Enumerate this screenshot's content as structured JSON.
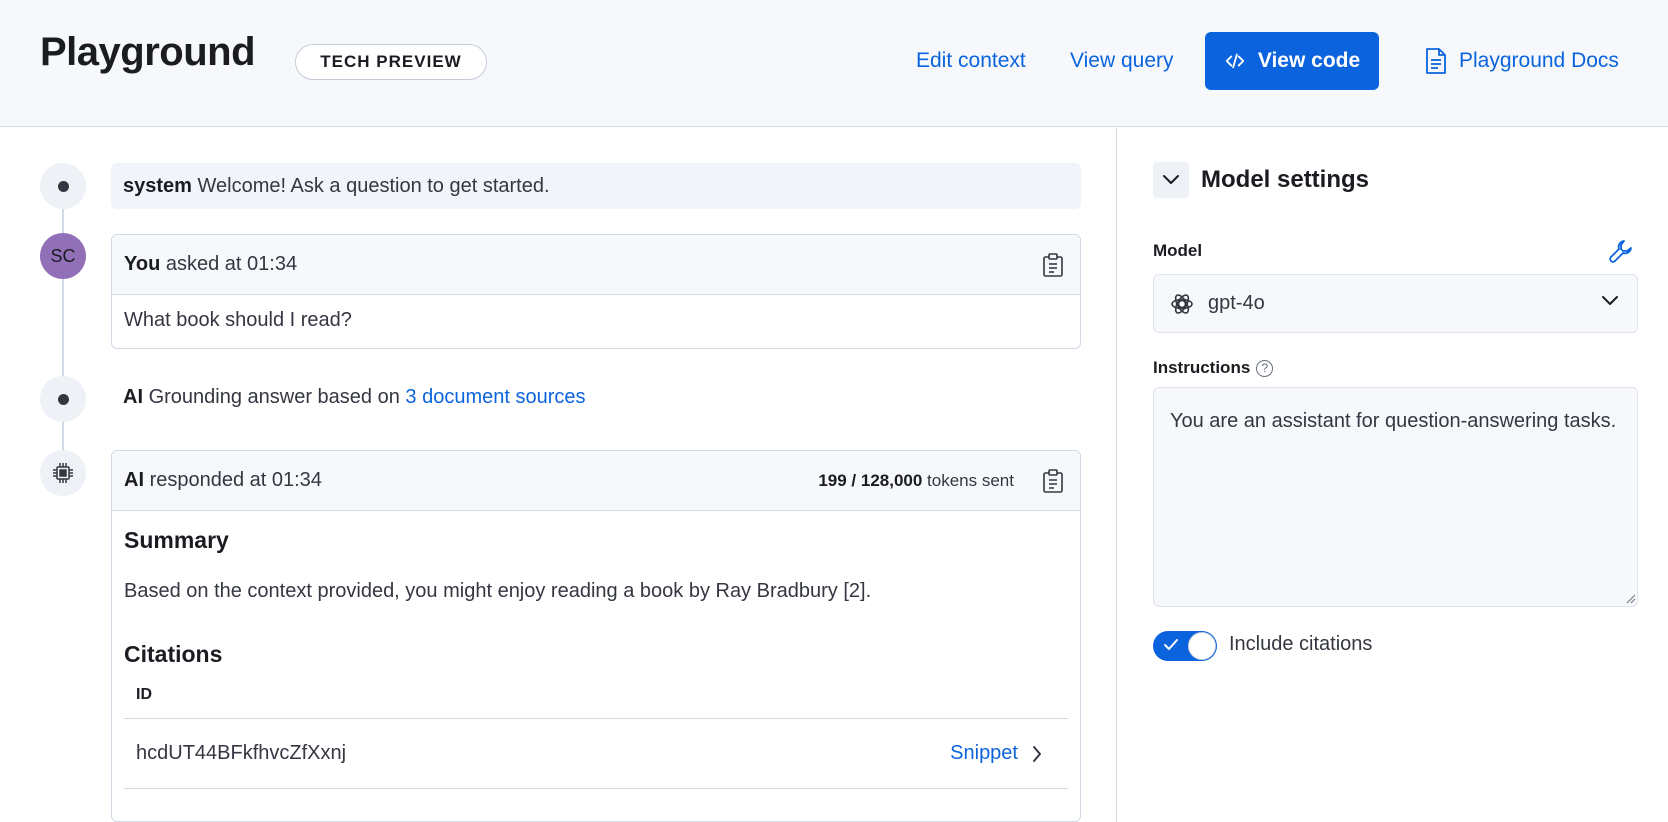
{
  "header": {
    "title": "Playground",
    "badge": "TECH PREVIEW",
    "edit_context": "Edit context",
    "view_query": "View query",
    "view_code": "View code",
    "docs": "Playground Docs"
  },
  "conversation": {
    "system": {
      "role": "system",
      "text": "Welcome! Ask a question to get started."
    },
    "user": {
      "avatar_initials": "SC",
      "role": "You",
      "meta": "asked at 01:34",
      "message": "What book should I read?"
    },
    "grounding": {
      "role": "AI",
      "text": "Grounding answer based on",
      "link": "3 document sources"
    },
    "ai": {
      "role": "AI",
      "meta": "responded at 01:34",
      "tokens_count": "199 / 128,000",
      "tokens_suffix": "tokens sent",
      "summary_heading": "Summary",
      "summary_text": "Based on the context provided, you might enjoy reading a book by Ray Bradbury [2].",
      "citations_heading": "Citations",
      "citations_column": "ID",
      "citations": [
        {
          "id": "hcdUT44BFkfhvcZfXxnj",
          "action": "Snippet"
        }
      ]
    }
  },
  "settings": {
    "title": "Model settings",
    "model_label": "Model",
    "model_value": "gpt-4o",
    "instructions_label": "Instructions",
    "instructions_value": "You are an assistant for question-answering tasks.",
    "include_citations_label": "Include citations",
    "include_citations": true
  },
  "colors": {
    "accent": "#0b64dd",
    "avatar": "#9170b8",
    "header_bg": "#f7f8fc"
  },
  "icons": [
    "code-icon",
    "document-icon",
    "copy-icon",
    "chip-icon",
    "chevron-down-icon",
    "wrench-icon",
    "openai-icon",
    "help-icon",
    "check-icon",
    "chevron-right-icon"
  ]
}
